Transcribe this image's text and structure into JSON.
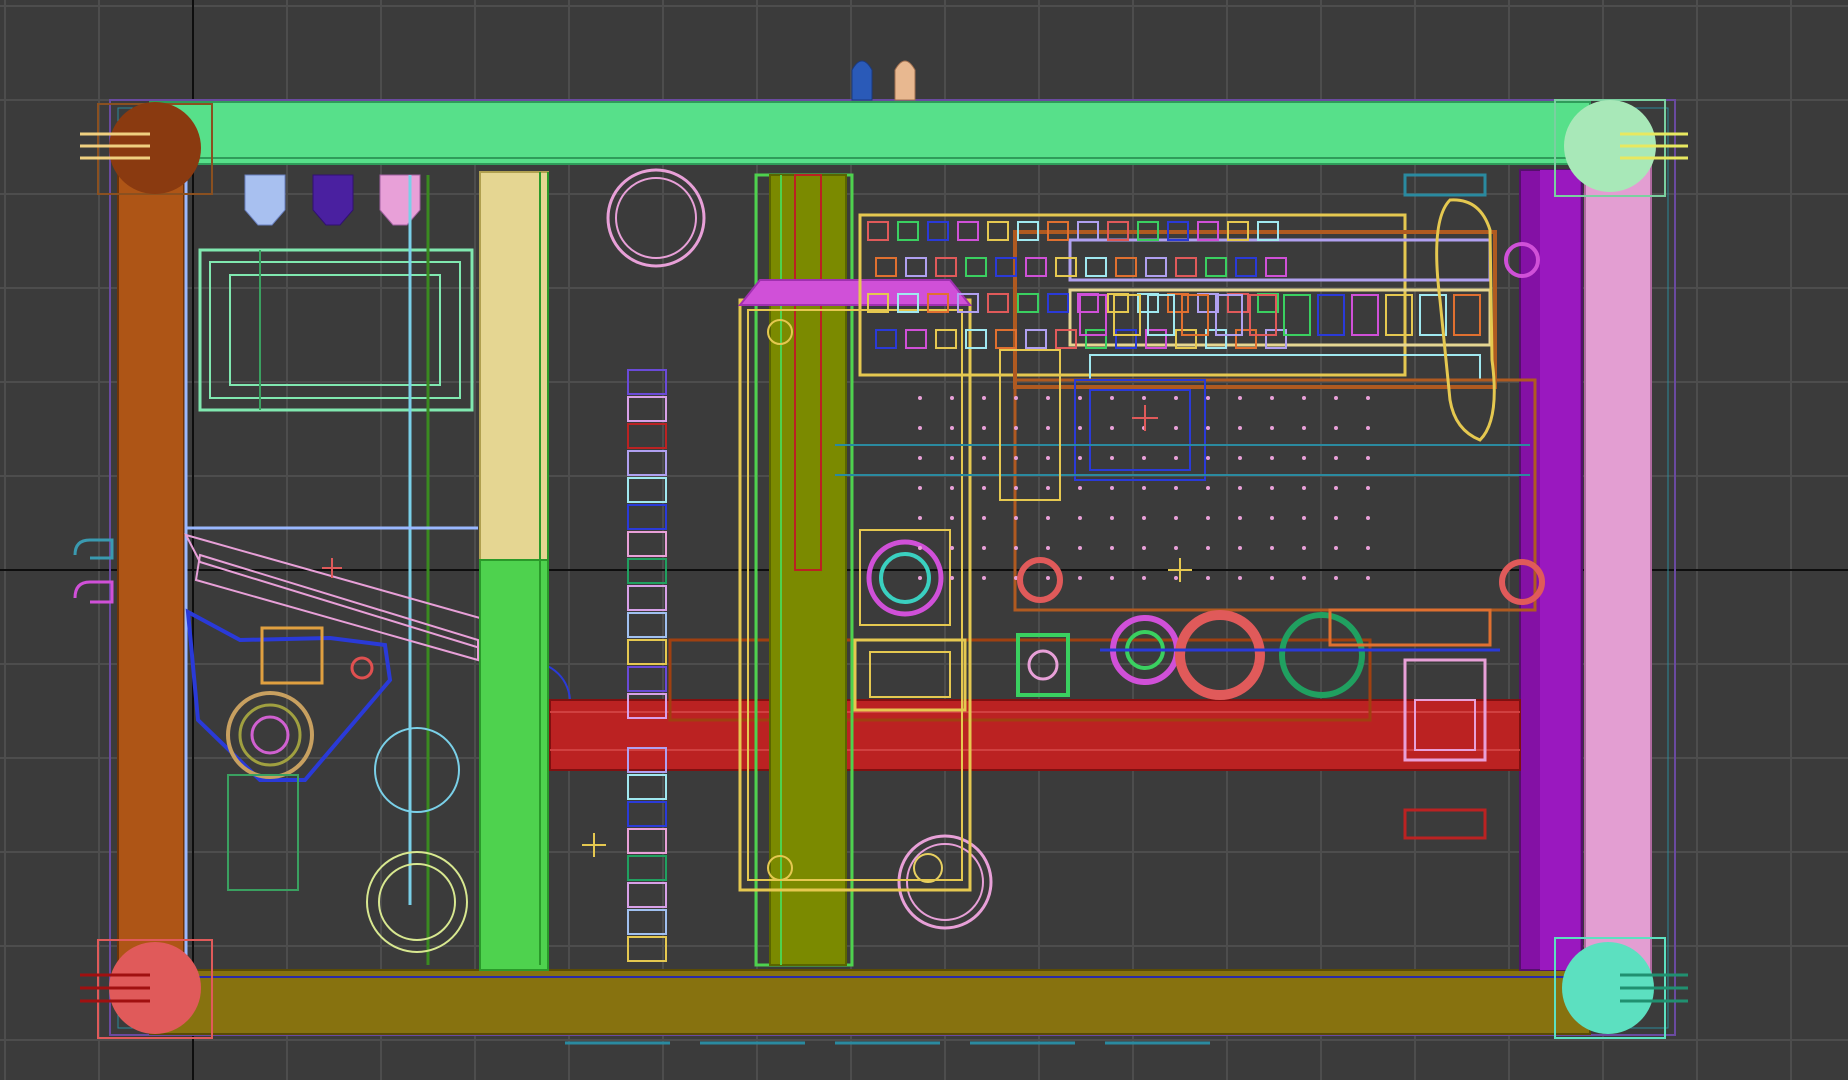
{
  "viewport": {
    "view": "top",
    "shading": "wireframe",
    "grid": true,
    "background_color": "#3b3b3b",
    "grid_color": "#4d4d4d",
    "axis_color": "#0d0d0d"
  },
  "model": {
    "colors": {
      "top_beam": "#57e08a",
      "bottom_beam": "#87720f",
      "left_beam": "#ae5516",
      "right_beam": "#e39ed2",
      "purple_rail": "#8411a5",
      "red_rail": "#bb2222",
      "green_rail": "#4ed24e",
      "olive_rail": "#7b8a00",
      "cream_rail": "#e5d692",
      "corner_top_left": "#8a3a10",
      "corner_top_right": "#a8e8b8",
      "corner_bottom_left": "#e05a5a",
      "corner_bottom_right": "#5ce0c0"
    }
  }
}
